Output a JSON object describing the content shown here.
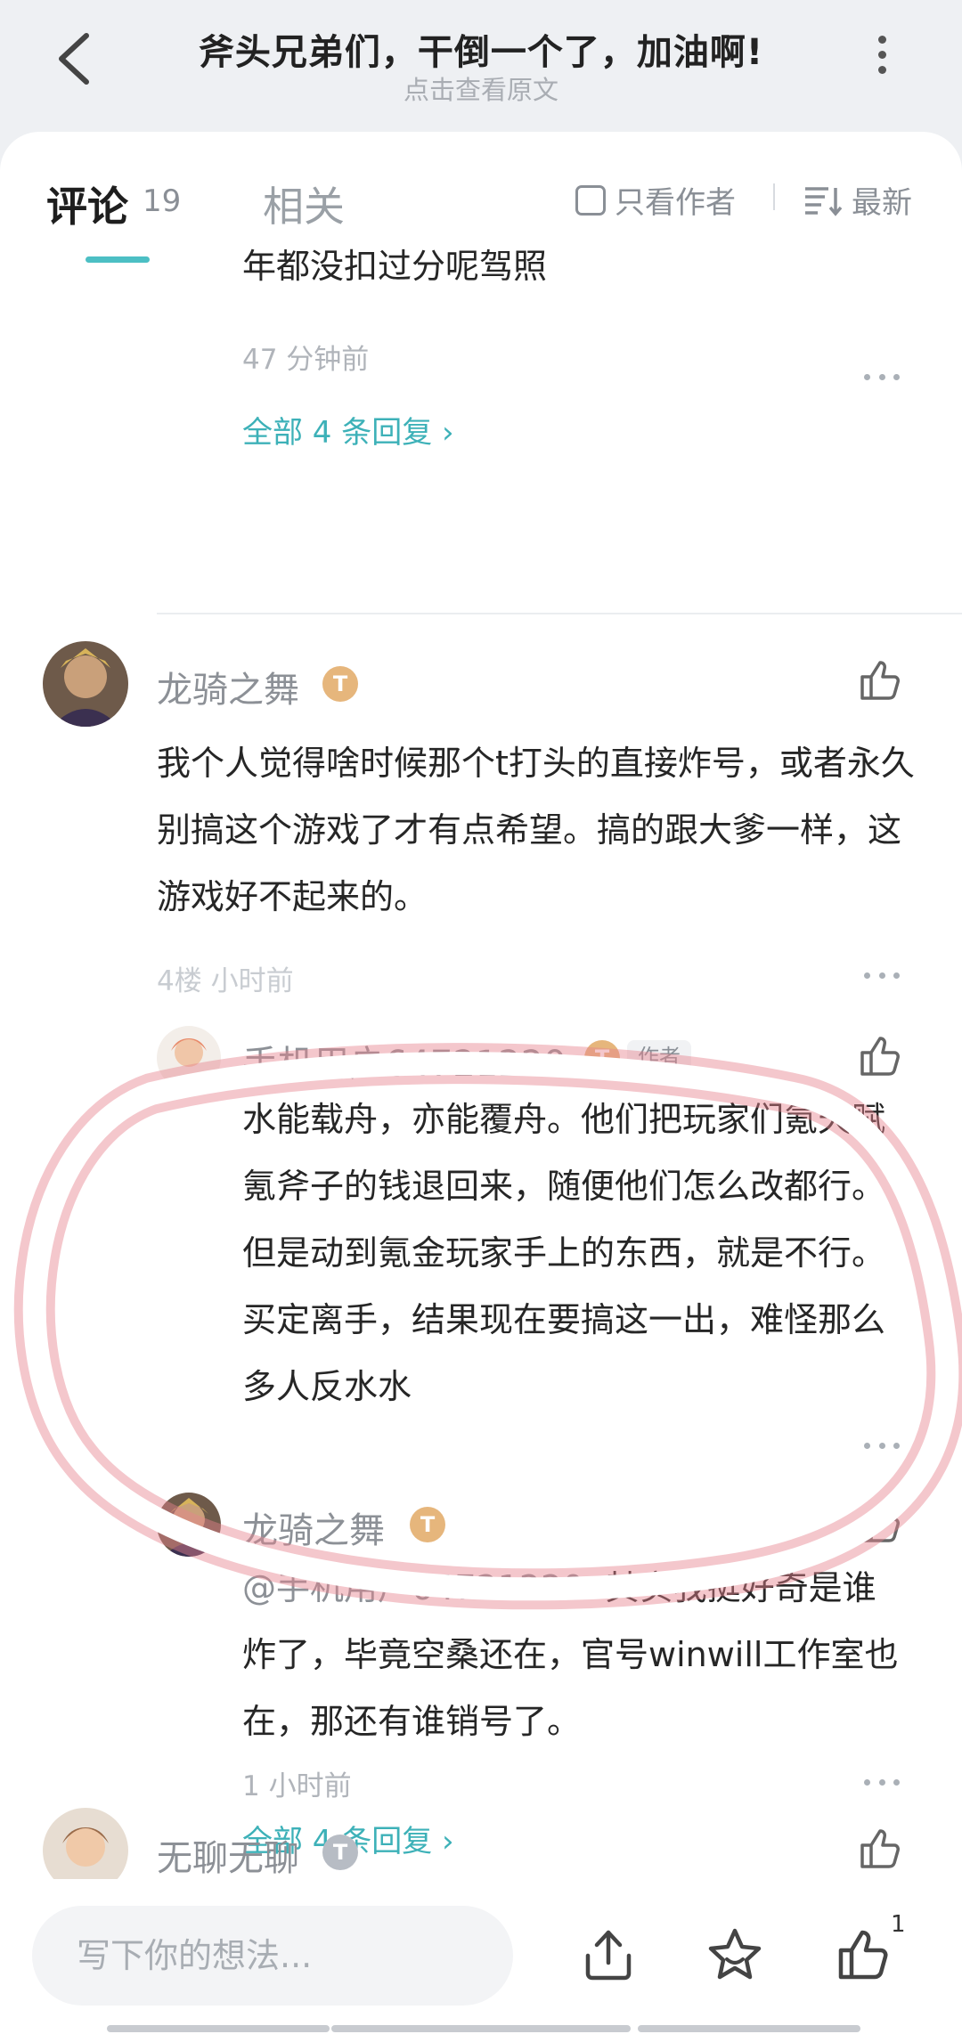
{
  "header": {
    "title": "斧头兄弟们，干倒一个了，加油啊!",
    "subtitle": "点击查看原文"
  },
  "tabs": {
    "comments_label": "评论",
    "comments_count": "19",
    "related_label": "相关",
    "author_only_label": "只看作者",
    "sort_label": "最新"
  },
  "prev_comment": {
    "text_tail": "年都没扣过分呢驾照",
    "time": "47 分钟前",
    "all_replies": "全部 4 条回复 ›"
  },
  "comment_main": {
    "username": "龙骑之舞",
    "level": "T",
    "text": "我个人觉得啥时候那个t打头的直接炸号，或者永久别搞这个游戏了才有点希望。搞的跟大爹一样，这游戏好不起来的。",
    "time": "4楼  小时前",
    "replies": [
      {
        "username": "手机用户64721220",
        "level": "T",
        "author_tag": "作者",
        "text": "水能载舟，亦能覆舟。他们把玩家们氪天赋氪斧子的钱退回来，随便他们怎么改都行。但是动到氪金玩家手上的东西，就是不行。买定离手，结果现在要搞这一出，难怪那么多人反水水"
      },
      {
        "username": "龙骑之舞",
        "level": "T",
        "mention": "@手机用户64721220",
        "text": "其实我挺好奇是谁炸了，毕竟空桑还在，官号winwill工作室也在，那还有谁销号了。",
        "time": "1 小时前"
      }
    ],
    "all_replies": "全部 4 条回复 ›"
  },
  "next_comment": {
    "username": "无聊无聊",
    "level": "T"
  },
  "bottom_bar": {
    "input_placeholder": "写下你的想法...",
    "like_count": "1"
  },
  "colors": {
    "accent": "#3db1b8",
    "badge_gold": "#e6b67c",
    "badge_grey": "#b7bcc4",
    "annotation_red": "#d94a5a"
  },
  "icons": [
    "back-icon",
    "more-icon",
    "checkbox-icon",
    "sort-icon",
    "like-icon",
    "share-icon",
    "star-icon",
    "thumb-up-icon"
  ]
}
